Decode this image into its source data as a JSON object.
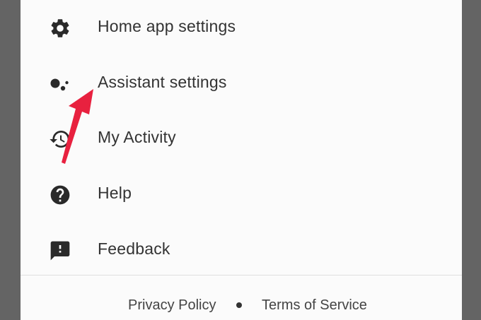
{
  "menu": {
    "items": [
      {
        "label": "Home app settings",
        "icon": "gear-icon"
      },
      {
        "label": "Assistant settings",
        "icon": "google-assistant-icon"
      },
      {
        "label": "My Activity",
        "icon": "history-icon"
      },
      {
        "label": "Help",
        "icon": "help-circle-icon"
      },
      {
        "label": "Feedback",
        "icon": "feedback-icon"
      }
    ]
  },
  "footer": {
    "privacy_label": "Privacy Policy",
    "separator": "•",
    "terms_label": "Terms of Service"
  },
  "colors": {
    "background": "#646464",
    "panel": "#fbfbfb",
    "text": "#333333",
    "icon": "#2a2a2a",
    "annotation_arrow": "#e8213f"
  }
}
